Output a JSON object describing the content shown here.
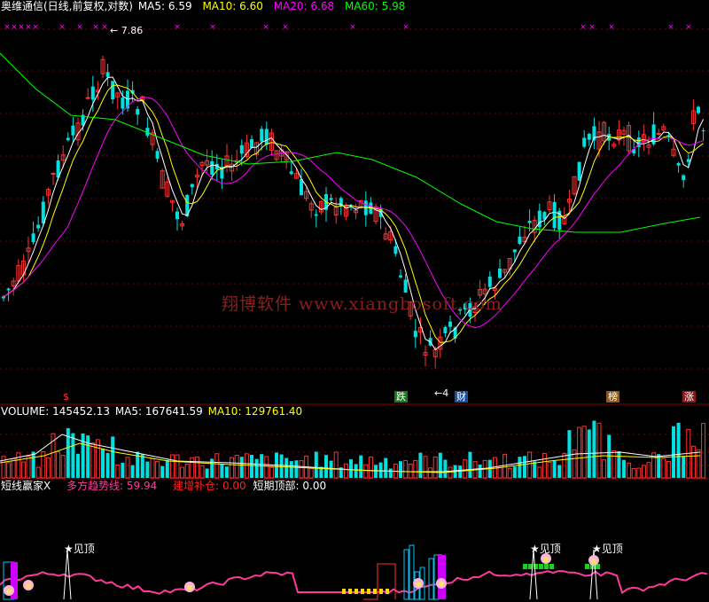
{
  "colors": {
    "up": "#ff3232",
    "down": "#00e0e0",
    "ma5": "#ffffff",
    "ma10": "#ffff00",
    "ma20": "#ff00ff",
    "ma60": "#00ff00",
    "pink": "#ff3a9c",
    "sep": "#8b0000"
  },
  "header": {
    "security": "奥维通信(日线,前复权,对数)",
    "ma5": "MA5: 6.59",
    "ma10": "MA10: 6.60",
    "ma20": "MA20: 6.68",
    "ma60": "MA60: 5.98"
  },
  "price_panel": {
    "high_label": "7.86",
    "low_label": "4",
    "watermark": "翔博软件 www.xiangbosoft.com"
  },
  "tags": [
    {
      "text": "$"
    },
    {
      "text": "跌"
    },
    {
      "text": "财"
    },
    {
      "text": "榜"
    },
    {
      "text": "涨"
    }
  ],
  "volume_header": {
    "volume": "VOLUME: 145452.13",
    "ma5": "MA5: 167641.59",
    "ma10": "MA10: 129761.40"
  },
  "indicator_header": {
    "name": "短线赢家X",
    "trend": "多方趋势线: 59.94",
    "add": "建增补仓: 0.00",
    "top": "短期顶部: 0.00"
  },
  "signal_labels": [
    "★见顶",
    "★见顶",
    "★见顶"
  ],
  "chart_data": {
    "type": "candlestick",
    "ma_series": [
      "MA5",
      "MA10",
      "MA20",
      "MA60"
    ],
    "ma_values": [
      6.59,
      6.6,
      6.68,
      5.98
    ],
    "price_high": 7.86,
    "price_low": 4,
    "volume": 145452.13,
    "volume_ma5": 167641.59,
    "volume_ma10": 129761.4,
    "trend_line": 59.94,
    "add_position": 0.0,
    "short_top": 0.0
  }
}
